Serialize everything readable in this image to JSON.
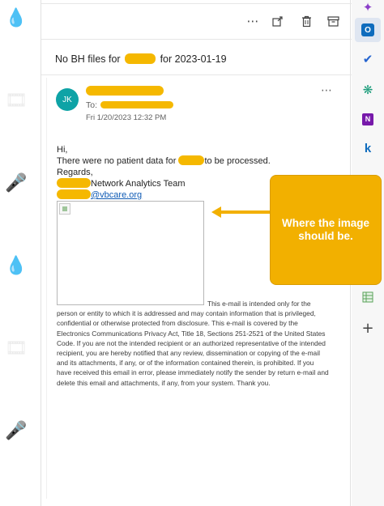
{
  "toolbar": {
    "more_glyph": "⋯",
    "icons": [
      "more-options-icon",
      "forward-to-icon",
      "delete-icon",
      "archive-icon"
    ]
  },
  "email": {
    "subject_prefix": "No BH files for",
    "subject_suffix": "for 2023-01-19",
    "sender_initials": "JK",
    "to_label": "To:",
    "date": "Fri 1/20/2023 12:32 PM",
    "body": {
      "greeting": "Hi,",
      "line1_prefix": "There were no patient data for",
      "line1_suffix": "to be processed.",
      "regards": "Regards,",
      "team": "Network Analytics Team",
      "email_suffix": "@vbcare.org"
    },
    "disclaimer_first": "This e-mail is intended only for the",
    "disclaimer_rest": "person or entity to which it is addressed and may contain information that is privileged, confidential or otherwise protected from disclosure. This e-mail is covered by the Electronics Communications Privacy Act, Title 18, Sections 251-2521 of the United States Code. If you are not the intended recipient or an authorized representative of the intended recipient, you are hereby notified that any review, dissemination or copying of the e-mail and its attachments, if any, or of the information contained therein, is prohibited. If you have received this email in error, please immediately notify the sender by return e-mail and delete this email and attachments, if any, from your system. Thank you."
  },
  "annotation": {
    "text": "Where the image should be.",
    "color": "#f2b000"
  },
  "sidebar": {
    "items": [
      "outlook-icon",
      "todo-check-icon",
      "copilot-icon",
      "onenote-icon",
      "klarna-k-icon",
      "spreadsheet-icon",
      "add-app-icon"
    ],
    "onenote_letter": "N",
    "outlook_letter": "O",
    "k_letter": "k"
  },
  "colors": {
    "redaction": "#f5b800",
    "avatar": "#0ea3a6",
    "link": "#0f5bb5"
  }
}
